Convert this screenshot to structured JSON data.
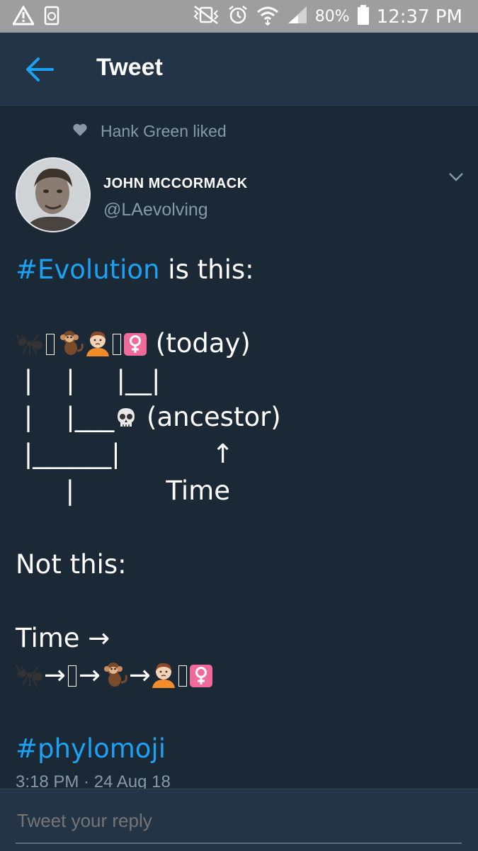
{
  "status_bar": {
    "battery_percent": "80%",
    "time": "12:37 PM",
    "icons_left": [
      "warning-icon",
      "recycle-icon"
    ],
    "icons_right": [
      "vibrate-icon",
      "alarm-icon",
      "wifi-icon",
      "signal-icon",
      "battery-icon"
    ]
  },
  "app_bar": {
    "title": "Tweet",
    "accent": "#1da1f2"
  },
  "social_context": {
    "text": "Hank Green liked"
  },
  "author": {
    "name": "JOHN MCCORMACK",
    "handle": "@LAevolving"
  },
  "tweet": {
    "hashtag1": "#Evolution",
    "line1_rest": " is this:",
    "today": " (today)",
    "tree_line2": " |    |     |__|",
    "tree_line3_left": " |    |___",
    "ancestor": " (ancestor)",
    "tree_line4": " |______|           ↑",
    "tree_line5": "      |           Time",
    "not_this": "Not this:",
    "time_arrow": "Time →",
    "arrow": "→",
    "hashtag2": "#phylomoji"
  },
  "timestamp": "3:18 PM · 24 Aug 18",
  "reply": {
    "placeholder": "Tweet your reply"
  }
}
